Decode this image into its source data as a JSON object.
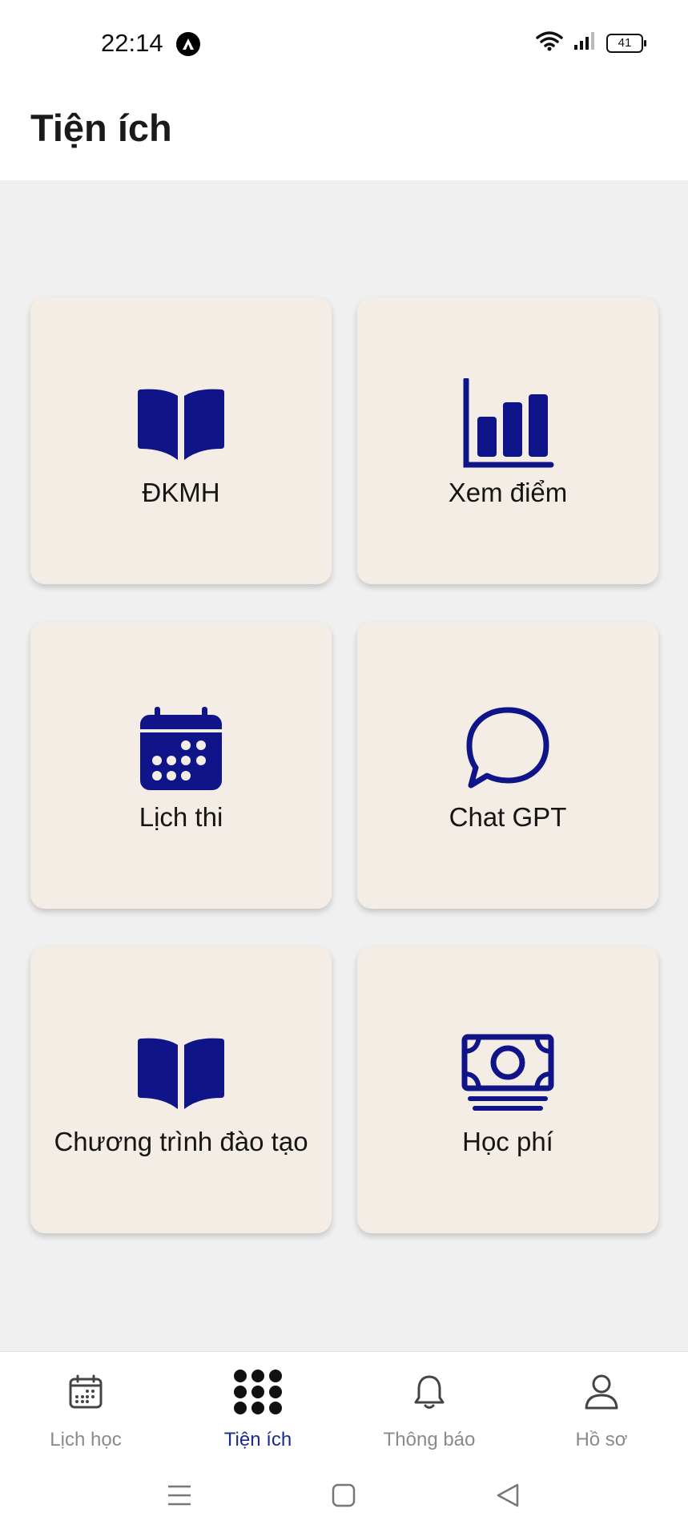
{
  "status_bar": {
    "time": "22:14",
    "battery": "41"
  },
  "header": {
    "title": "Tiện ích"
  },
  "tiles": [
    {
      "label": "ĐKMH",
      "icon": "open-book-icon"
    },
    {
      "label": "Xem điểm",
      "icon": "bar-chart-icon"
    },
    {
      "label": "Lịch thi",
      "icon": "calendar-icon"
    },
    {
      "label": "Chat GPT",
      "icon": "chat-bubble-icon"
    },
    {
      "label": "Chương trình đào tạo",
      "icon": "open-book-icon"
    },
    {
      "label": "Học phí",
      "icon": "banknote-icon"
    }
  ],
  "bottom_nav": [
    {
      "label": "Lịch học",
      "icon": "calendar-icon",
      "active": false
    },
    {
      "label": "Tiện ích",
      "icon": "dots-grid-icon",
      "active": true
    },
    {
      "label": "Thông báo",
      "icon": "bell-icon",
      "active": false
    },
    {
      "label": "Hồ sơ",
      "icon": "user-icon",
      "active": false
    }
  ],
  "colors": {
    "accent": "#0f1589",
    "tile_background": "#f4ede6",
    "page_background": "#f0f0f0",
    "nav_inactive": "#8a8a8a",
    "nav_active": "#1d2a8c"
  }
}
